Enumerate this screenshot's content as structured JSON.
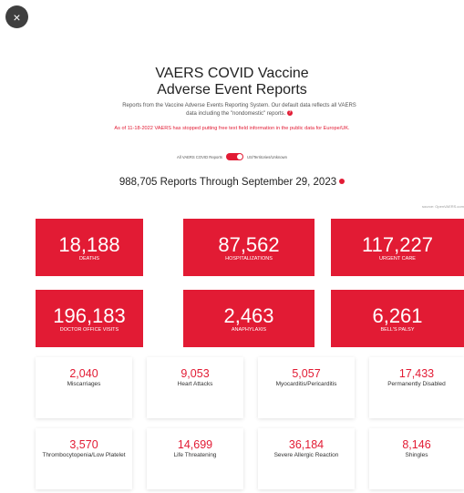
{
  "close_icon": "×",
  "header": {
    "title_line1": "VAERS COVID Vaccine",
    "title_line2": "Adverse Event Reports",
    "intro": "Reports from the Vaccine Adverse Events Reporting System. Our default data reflects all VAERS data including the \"nondomestic\" reports.",
    "info_icon": "?",
    "warning": "As of 11-18-2022 VAERS has stopped putting free text field information in the public data for Europe/UK."
  },
  "toggle": {
    "left_label": "All VAERS COVID Reports",
    "right_label": "US/Territories/Unknown",
    "state": "on"
  },
  "report_total": "988,705 Reports Through September 29, 2023",
  "source": "source: OpenVAERS.com",
  "colors": {
    "accent": "#e21b34",
    "card_bg": "#ffffff",
    "close_bg": "#3f3f3f"
  },
  "red_cards": [
    {
      "value": "18,188",
      "label": "DEATHS"
    },
    {
      "value": "87,562",
      "label": "HOSPITALIZATIONS"
    },
    {
      "value": "117,227",
      "label": "URGENT CARE"
    },
    {
      "value": "196,183",
      "label": "DOCTOR OFFICE VISITS"
    },
    {
      "value": "2,463",
      "label": "ANAPHYLAXIS"
    },
    {
      "value": "6,261",
      "label": "BELL'S PALSY"
    }
  ],
  "white_cards": [
    {
      "value": "2,040",
      "label": "Miscarriages"
    },
    {
      "value": "9,053",
      "label": "Heart Attacks"
    },
    {
      "value": "5,057",
      "label": "Myocarditis/Pericarditis"
    },
    {
      "value": "17,433",
      "label": "Permanently Disabled"
    },
    {
      "value": "3,570",
      "label": "Thrombocytopenia/Low Platelet"
    },
    {
      "value": "14,699",
      "label": "Life Threatening"
    },
    {
      "value": "36,184",
      "label": "Severe Allergic Reaction"
    },
    {
      "value": "8,146",
      "label": "Shingles"
    }
  ]
}
